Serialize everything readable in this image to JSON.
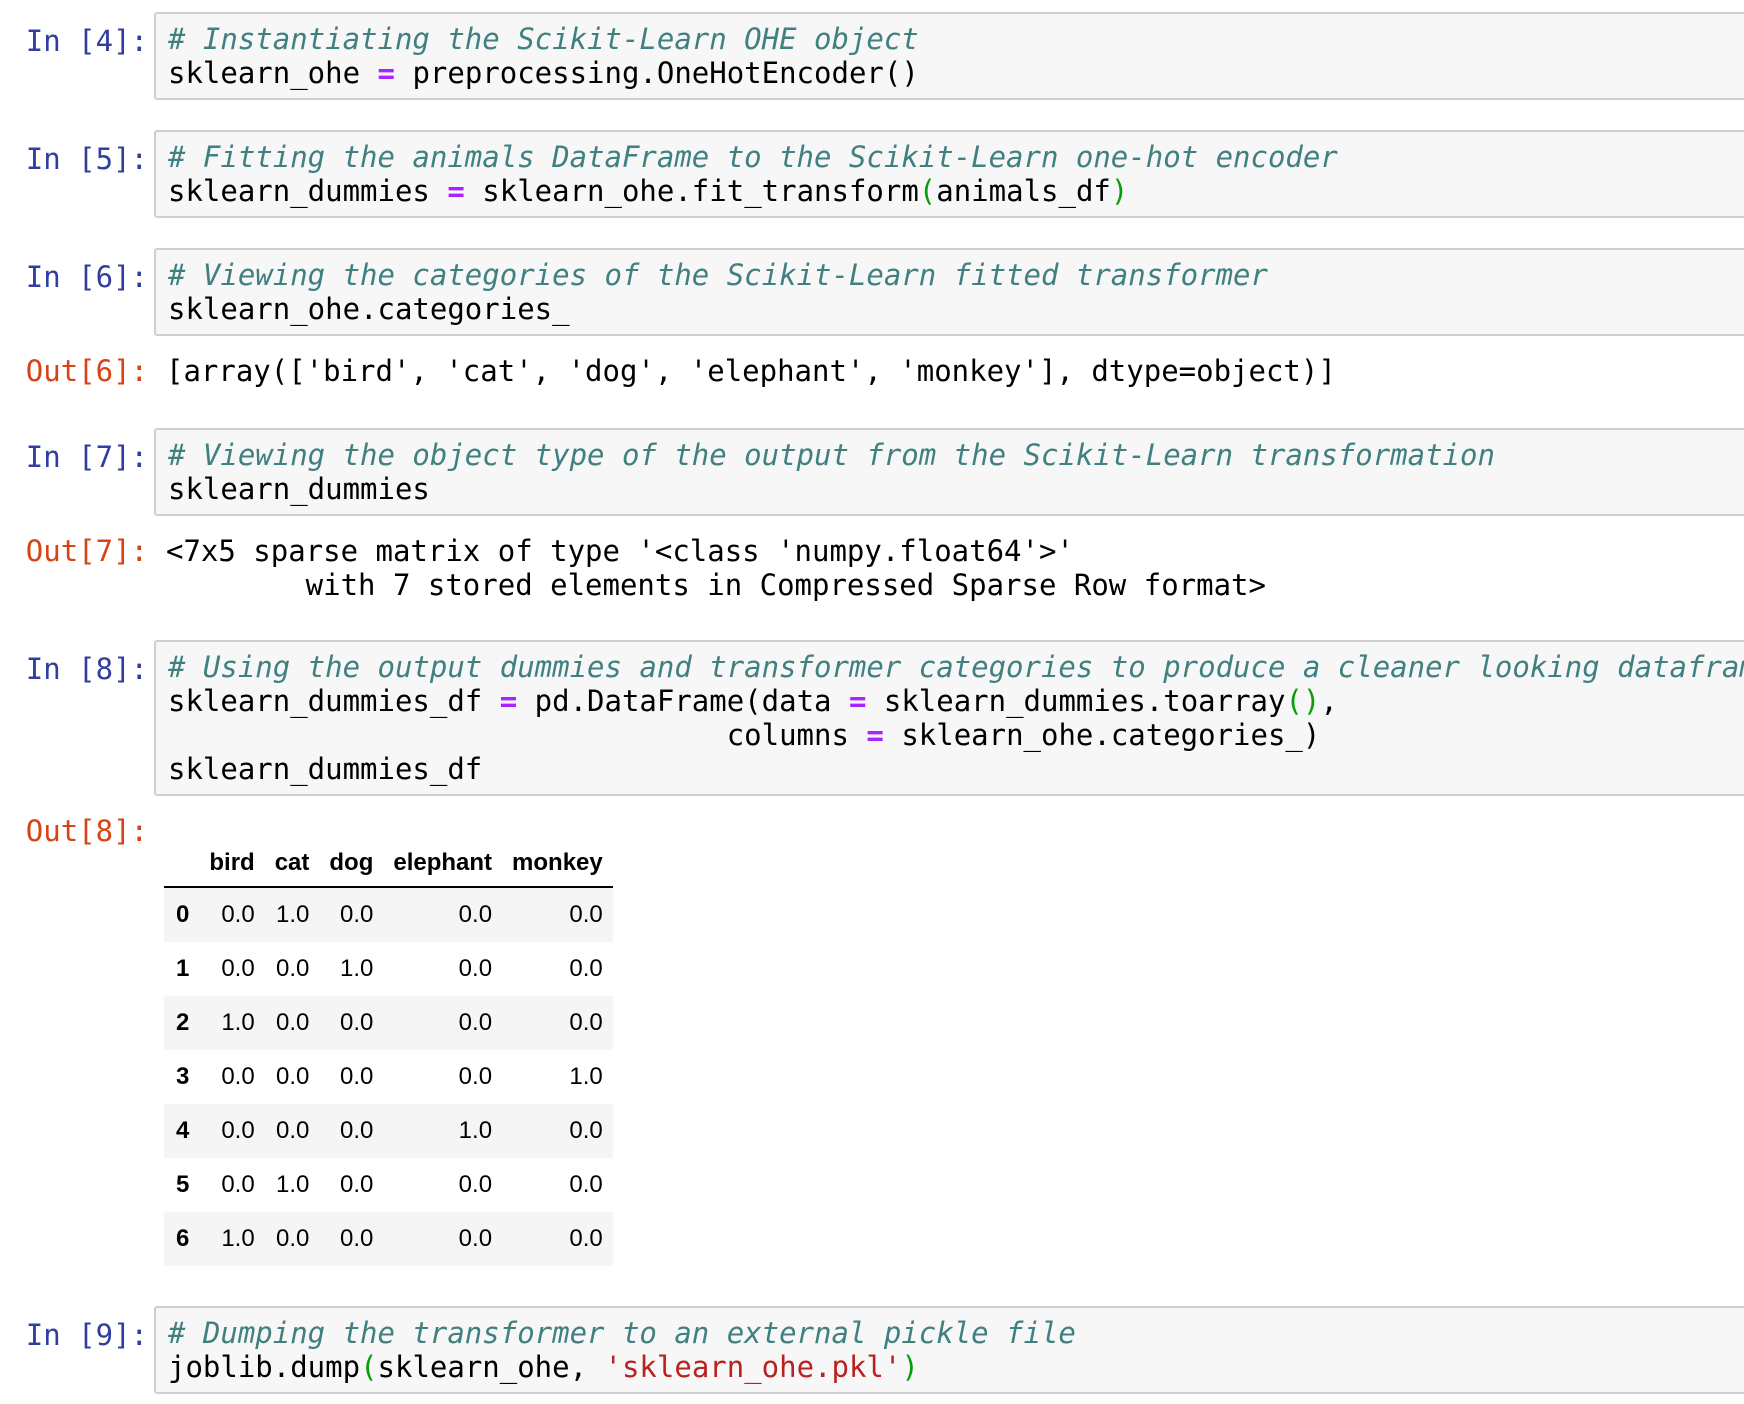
{
  "cells": [
    {
      "prompt": "In [4]:",
      "comment": "# Instantiating the Scikit-Learn OHE object",
      "code": [
        "sklearn_ohe",
        " = ",
        "preprocessing.OneHotEncoder()"
      ]
    },
    {
      "prompt": "In [5]:",
      "comment": "# Fitting the animals DataFrame to the Scikit-Learn one-hot encoder",
      "code": [
        "sklearn_dummies",
        " = ",
        "sklearn_ohe.fit_transform",
        "(",
        "animals_df",
        ")"
      ]
    },
    {
      "prompt": "In [6]:",
      "comment": "# Viewing the categories of the Scikit-Learn fitted transformer",
      "code": [
        "sklearn_ohe.categories_"
      ]
    },
    {
      "prompt": "In [7]:",
      "comment": "# Viewing the object type of the output from the Scikit-Learn transformation",
      "code": [
        "sklearn_dummies"
      ]
    },
    {
      "prompt": "In [8]:",
      "comment": "# Using the output dummies and transformer categories to produce a cleaner looking dataframe",
      "code": [
        "sklearn_dummies_df",
        " = ",
        "pd.DataFrame(data ",
        "=",
        " sklearn_dummies.toarray",
        "()",
        ",",
        "                                columns ",
        "=",
        " sklearn_ohe.categories_)",
        "sklearn_dummies_df"
      ]
    },
    {
      "prompt": "In [9]:",
      "comment": "# Dumping the transformer to an external pickle file",
      "code": [
        "joblib.dump",
        "(",
        "sklearn_ohe, ",
        "'sklearn_ohe.pkl'",
        ")"
      ]
    }
  ],
  "outputs": [
    {
      "prompt": "Out[6]:",
      "lines": [
        "[array(['bird', 'cat', 'dog', 'elephant', 'monkey'], dtype=object)]"
      ]
    },
    {
      "prompt": "Out[7]:",
      "lines": [
        "<7x5 sparse matrix of type '<class 'numpy.float64'>'",
        "        with 7 stored elements in Compressed Sparse Row format>"
      ]
    },
    {
      "prompt": "Out[8]:",
      "lines": []
    }
  ],
  "dataframe": {
    "columns": [
      "bird",
      "cat",
      "dog",
      "elephant",
      "monkey"
    ],
    "rows": [
      {
        "index": "0",
        "values": [
          "0.0",
          "1.0",
          "0.0",
          "0.0",
          "0.0"
        ]
      },
      {
        "index": "1",
        "values": [
          "0.0",
          "0.0",
          "1.0",
          "0.0",
          "0.0"
        ]
      },
      {
        "index": "2",
        "values": [
          "1.0",
          "0.0",
          "0.0",
          "0.0",
          "0.0"
        ]
      },
      {
        "index": "3",
        "values": [
          "0.0",
          "0.0",
          "0.0",
          "0.0",
          "1.0"
        ]
      },
      {
        "index": "4",
        "values": [
          "0.0",
          "0.0",
          "0.0",
          "1.0",
          "0.0"
        ]
      },
      {
        "index": "5",
        "values": [
          "0.0",
          "1.0",
          "0.0",
          "0.0",
          "0.0"
        ]
      },
      {
        "index": "6",
        "values": [
          "1.0",
          "0.0",
          "0.0",
          "0.0",
          "0.0"
        ]
      }
    ]
  },
  "colors": {
    "in_prompt": "#303f9f",
    "out_prompt": "#d84315",
    "comment": "#408080",
    "operator": "#aa22ff",
    "paren": "#0a9c0a",
    "string": "#ba2121"
  }
}
